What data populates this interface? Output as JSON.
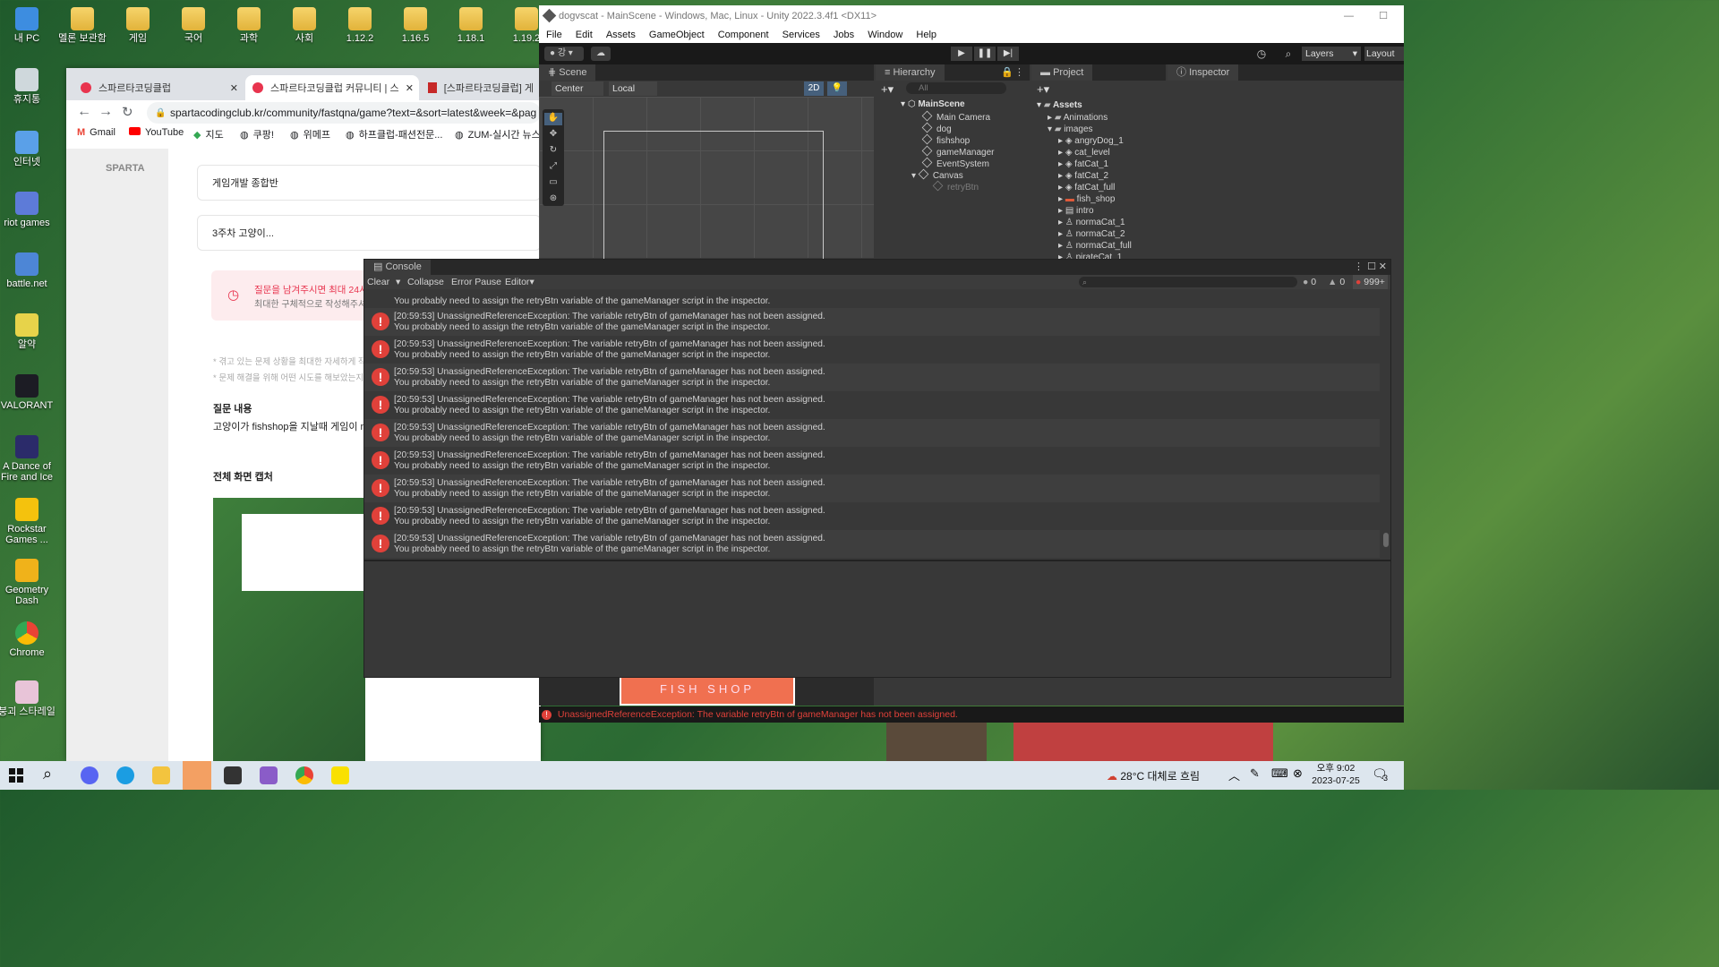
{
  "desktop_icons": [
    {
      "label": "내 PC"
    },
    {
      "label": "멜론 보관함"
    },
    {
      "label": "게임"
    },
    {
      "label": "국어"
    },
    {
      "label": "과학"
    },
    {
      "label": "사회"
    },
    {
      "label": "1.12.2"
    },
    {
      "label": "1.16.5"
    },
    {
      "label": "1.18.1"
    },
    {
      "label": "1.19.2"
    },
    {
      "label": "휴지통"
    },
    {
      "label": "인터넷"
    },
    {
      "label": "riot games"
    },
    {
      "label": "battle.net"
    },
    {
      "label": "알약"
    },
    {
      "label": "VALORANT"
    },
    {
      "label": "A Dance of Fire and Ice"
    },
    {
      "label": "Rockstar Games ..."
    },
    {
      "label": "Geometry Dash"
    },
    {
      "label": "Chrome"
    },
    {
      "label": "붕괴 스타레일"
    }
  ],
  "browser": {
    "tabs": [
      "스파르타코딩클럽",
      "스파르타코딩클럽 커뮤니티 | 스",
      "[스파르타코딩클럽] 게"
    ],
    "url": "spartacodingclub.kr/community/fastqna/game?text=&sort=latest&week=&pag",
    "bookmarks": [
      "Gmail",
      "YouTube",
      "지도",
      "쿠팡!",
      "위메프",
      "하프클럽-패션전문...",
      "ZUM-실시간 뉴스"
    ],
    "course": "게임개발 종합반",
    "title_field": "3주차 고양이...",
    "notice_line1": "질문을 남겨주시면 최대 24시간",
    "notice_line2": "최대한 구체적으로 작성해주셔야",
    "hint1": "* 겪고 있는 문제 상황을 최대한 자세하게 작",
    "hint2": "* 문제 해결을 위해 어떤 시도를 해보았는지",
    "question_heading": "질문 내용",
    "question_text": "고양이가 fishshop을 지날때 게임이 n",
    "capture_heading": "전체 화면 캡처"
  },
  "unity": {
    "title": "dogvscat - MainScene - Windows, Mac, Linux - Unity 2022.3.4f1 <DX11>",
    "menu": [
      "File",
      "Edit",
      "Assets",
      "GameObject",
      "Component",
      "Services",
      "Jobs",
      "Window",
      "Help"
    ],
    "account": "강",
    "layers": "Layers",
    "layout": "Layout",
    "scene_tab": "Scene",
    "center": "Center",
    "local": "Local",
    "mode2d": "2D",
    "hierarchy_tab": "Hierarchy",
    "hierarchy_search": "All",
    "hierarchy": [
      "MainScene",
      "Main Camera",
      "dog",
      "fishshop",
      "gameManager",
      "EventSystem",
      "Canvas",
      "retryBtn"
    ],
    "project_tab": "Project",
    "inspector_tab": "Inspector",
    "assets_root": "Assets",
    "assets": [
      "Animations",
      "images",
      "angryDog_1",
      "cat_level",
      "fatCat_1",
      "fatCat_2",
      "fatCat_full",
      "fish_shop",
      "intro",
      "normaCat_1",
      "normaCat_2",
      "normaCat_full",
      "pirateCat_1"
    ],
    "console": {
      "tab": "Console",
      "buttons": [
        "Clear",
        "Collapse",
        "Error Pause",
        "Editor"
      ],
      "info_count": "0",
      "warn_count": "0",
      "error_count": "999+",
      "partial_line": "You probably need to assign the retryBtn variable of the gameManager script in the inspector.",
      "line1": "[20:59:53] UnassignedReferenceException: The variable retryBtn of gameManager has not been assigned.",
      "line2": "You probably need to assign the retryBtn variable of the gameManager script in the inspector.",
      "status": "UnassignedReferenceException: The variable retryBtn of gameManager has not been assigned."
    },
    "game_sign": "FISH SHOP"
  },
  "taskbar": {
    "weather": "28°C  대체로 흐림",
    "time": "오후 9:02",
    "date": "2023-07-25",
    "notif": "3"
  },
  "colors": {
    "error": "#e0413a",
    "unity_bg": "#383838",
    "accent": "#3a72b0"
  }
}
